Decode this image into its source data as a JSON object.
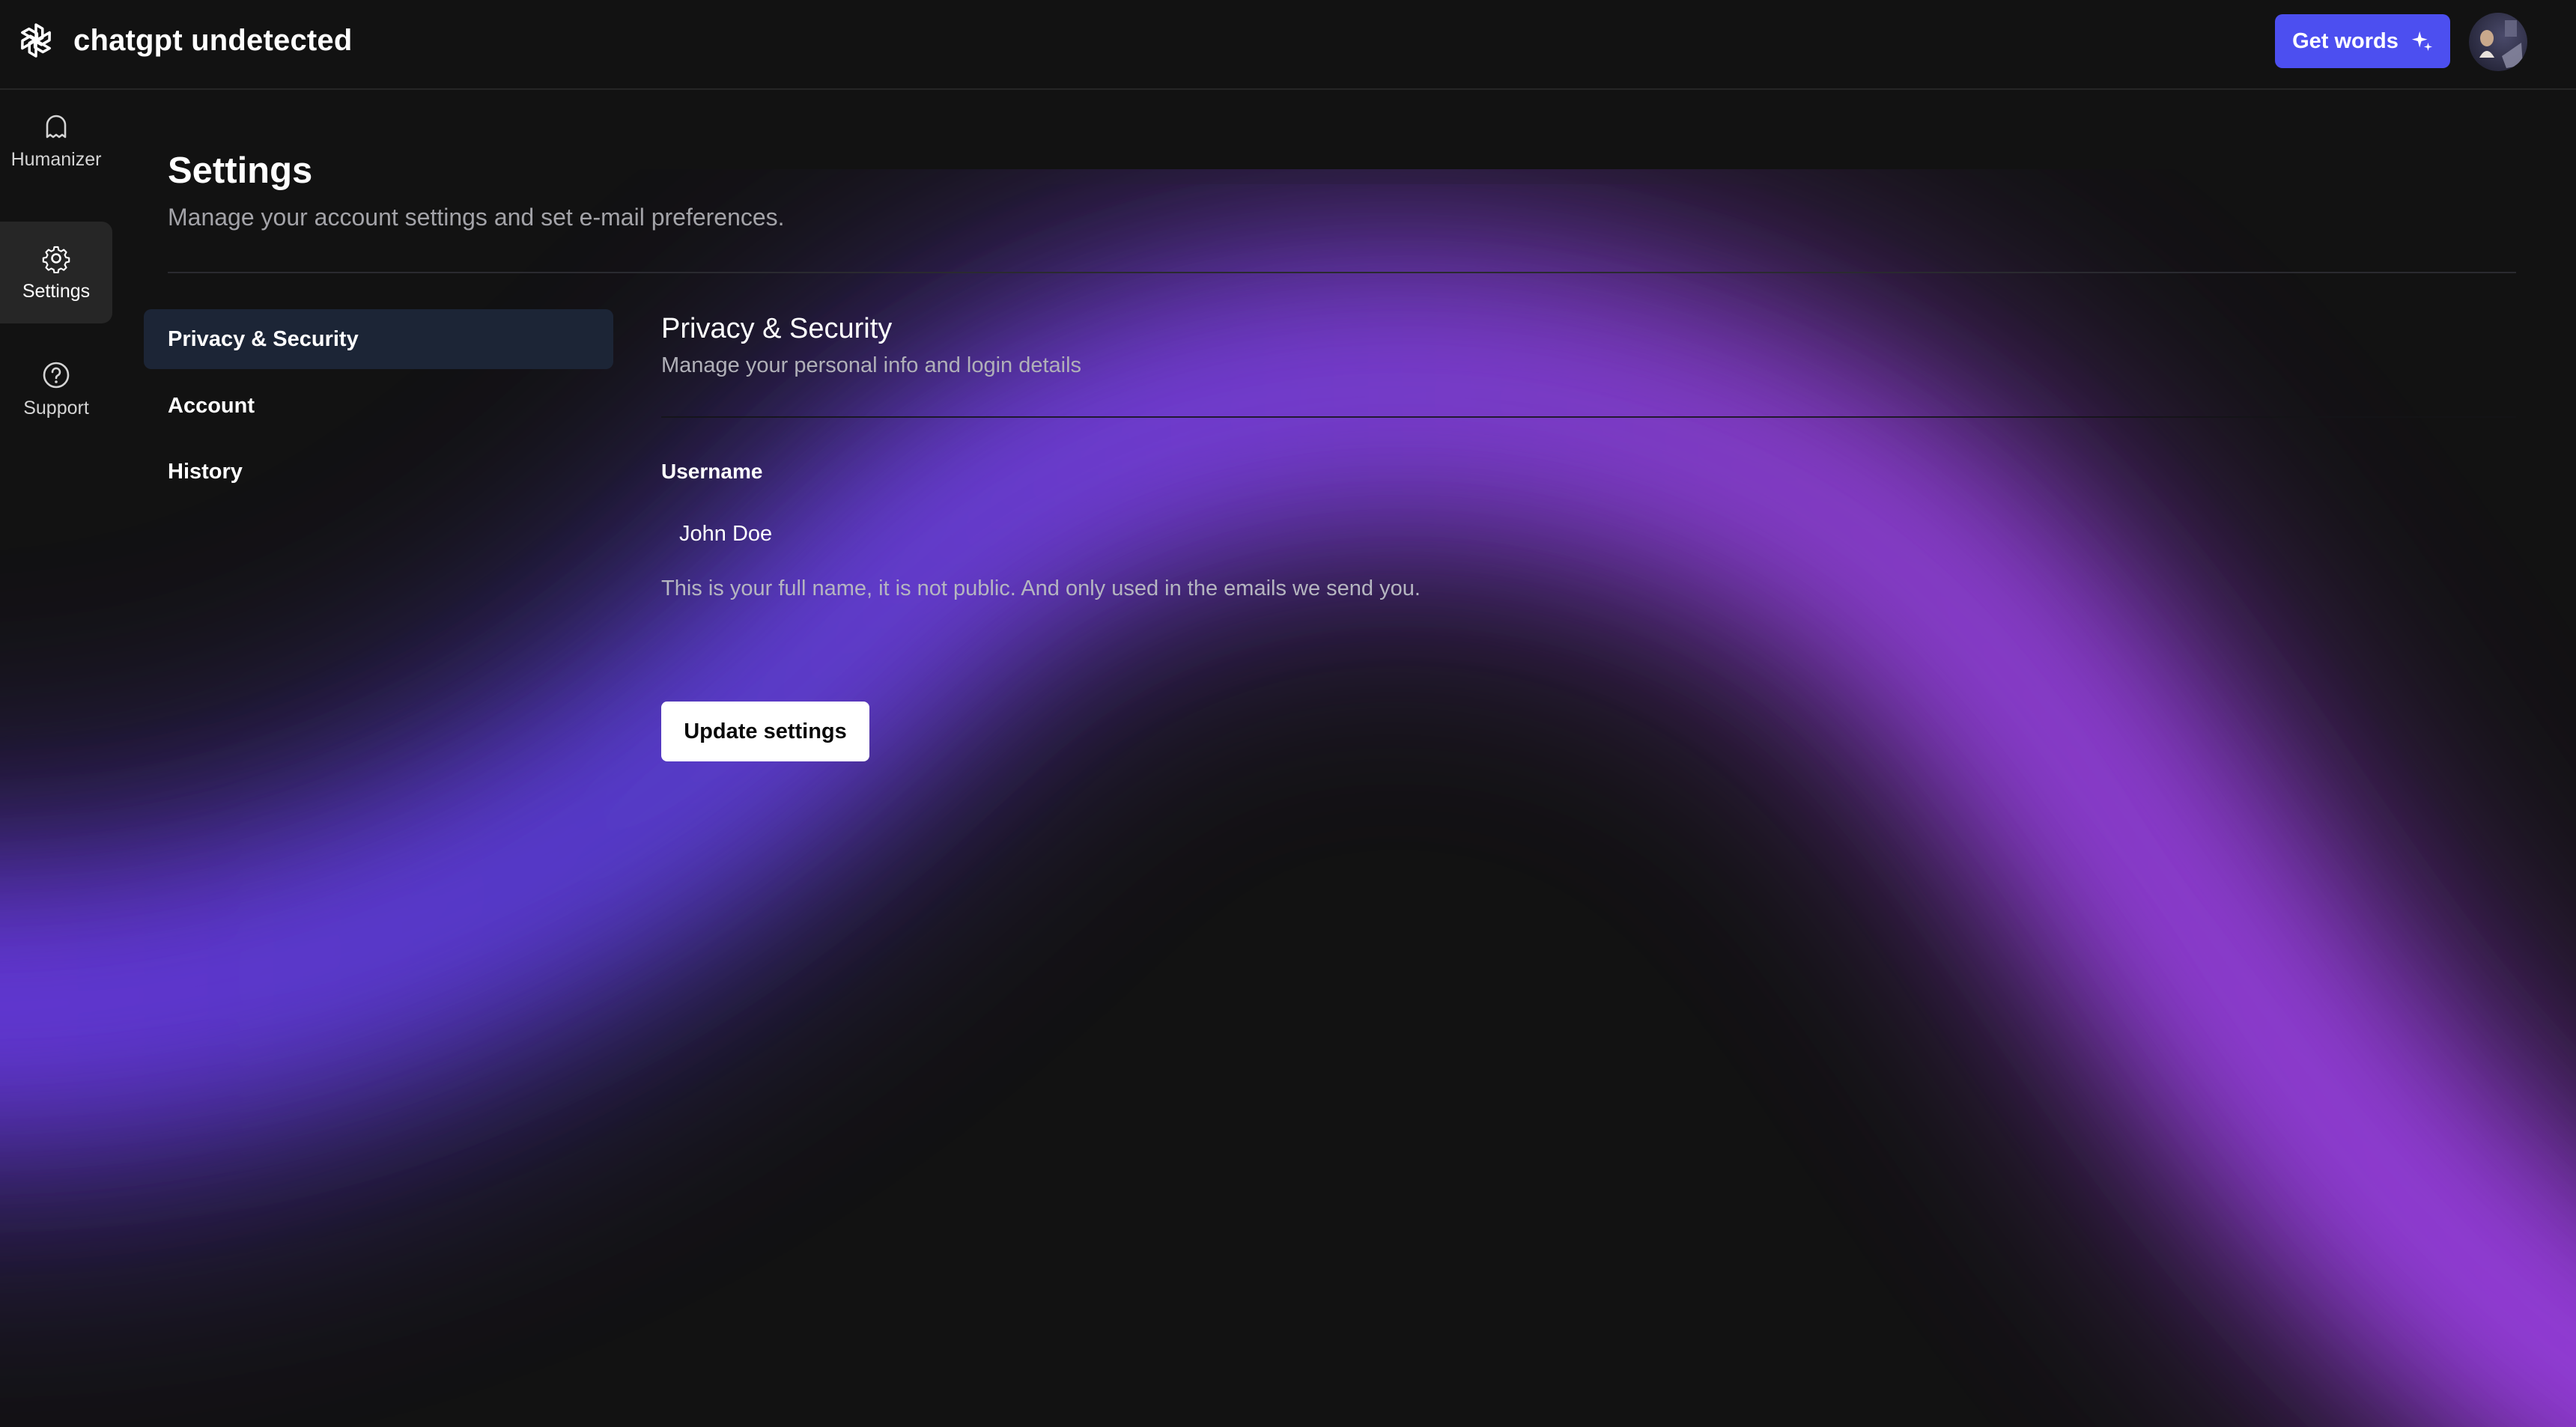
{
  "app": {
    "name": "chatgpt undetected",
    "logo_icon": "openai-logo-icon"
  },
  "header": {
    "cta_label": "Get words",
    "cta_icon": "sparkle-icon",
    "accent_color": "#4c4ff0"
  },
  "rail": {
    "items": [
      {
        "label": "Humanizer",
        "icon": "ghost-icon",
        "active": false
      },
      {
        "label": "Settings",
        "icon": "gear-icon",
        "active": true
      },
      {
        "label": "Support",
        "icon": "help-circle-icon",
        "active": false
      }
    ]
  },
  "page": {
    "title": "Settings",
    "subtitle": "Manage your account settings and set e-mail preferences."
  },
  "subnav": {
    "items": [
      {
        "label": "Privacy & Security",
        "active": true
      },
      {
        "label": "Account",
        "active": false
      },
      {
        "label": "History",
        "active": false
      }
    ]
  },
  "section": {
    "title": "Privacy & Security",
    "subtitle": "Manage your personal info and login details",
    "username": {
      "label": "Username",
      "value": "John Doe",
      "help": "This is your full name, it is not public. And only used in the emails we send you."
    },
    "update_button_label": "Update settings"
  },
  "theme": {
    "background": "#121212",
    "glow_purple": "#9a3fe0",
    "glow_indigo": "#5b3fd8"
  }
}
